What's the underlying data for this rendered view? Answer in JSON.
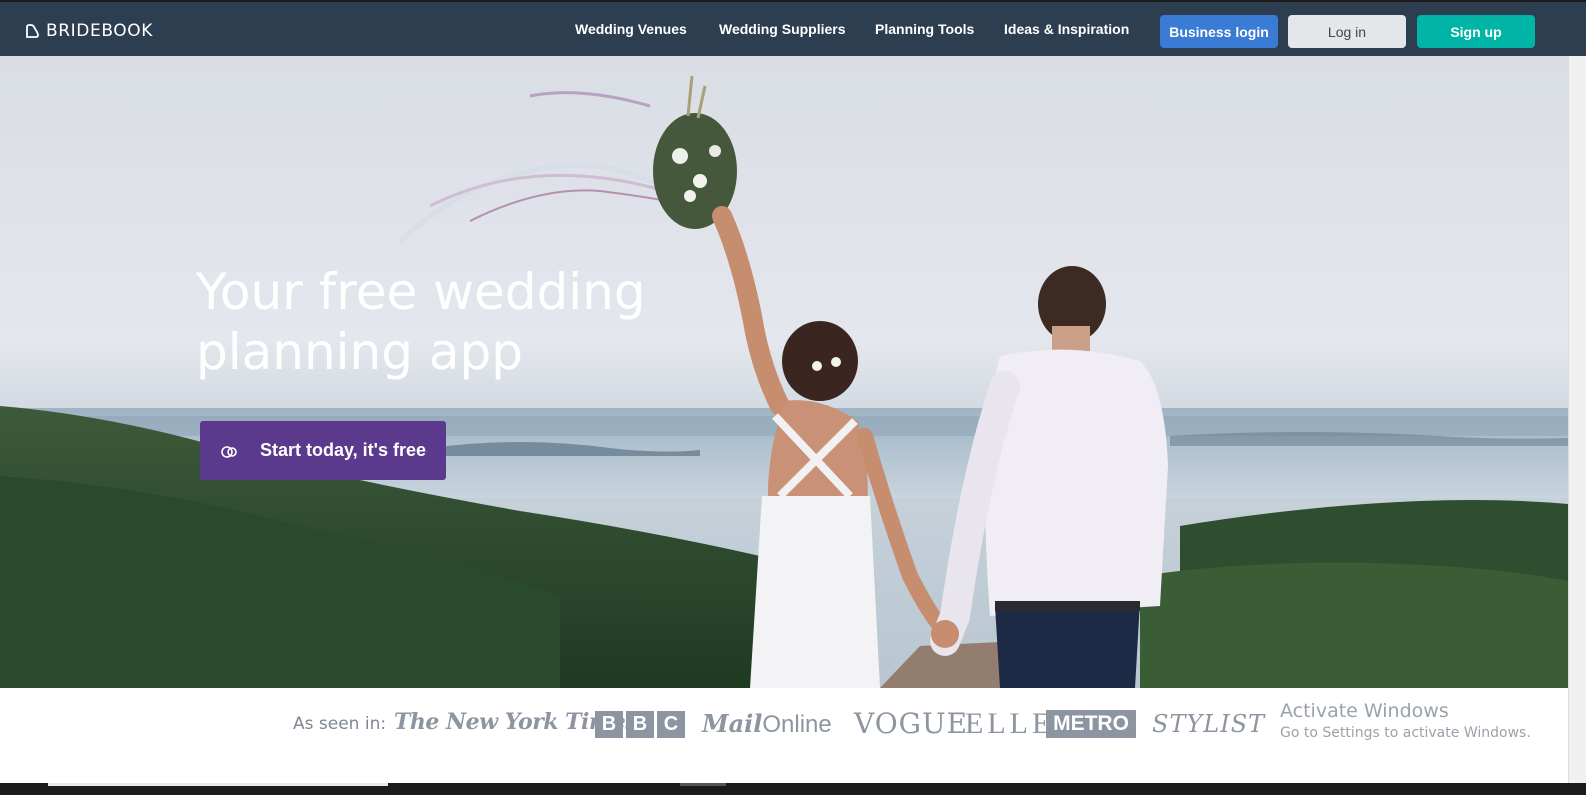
{
  "header": {
    "logo_text": "BRIDEBOOK",
    "nav": [
      {
        "label": "Wedding Venues"
      },
      {
        "label": "Wedding Suppliers"
      },
      {
        "label": "Planning Tools"
      },
      {
        "label": "Ideas & Inspiration"
      }
    ],
    "business_login": "Business login",
    "log_in": "Log in",
    "sign_up": "Sign up"
  },
  "hero": {
    "title_line1": "Your free wedding",
    "title_line2": "planning app",
    "cta_label": "Start today, it's free",
    "cta_icon": "rings-icon"
  },
  "press": {
    "label": "As seen in:",
    "logos": [
      "The New York Times",
      "BBC",
      "MailOnline",
      "VOGUE",
      "ELLE",
      "METRO",
      "STYLIST"
    ]
  },
  "watermark": {
    "title": "Activate Windows",
    "subtitle": "Go to Settings to activate Windows."
  },
  "colors": {
    "header_bg": "#2c3e50",
    "business_login": "#3a7bd5",
    "sign_up": "#00b5a5",
    "cta": "#5b3a8e"
  }
}
